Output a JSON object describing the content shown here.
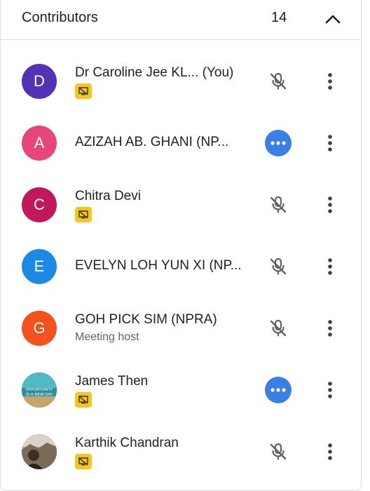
{
  "header": {
    "title": "Contributors",
    "count": "14",
    "collapse_icon": "chevron-up-icon"
  },
  "participants": [
    {
      "initial": "D",
      "name": "Dr Caroline Jee KL...",
      "tag": "(You)",
      "subtitle": "",
      "color": "#5133b8",
      "badge": true,
      "status": "mic-off"
    },
    {
      "initial": "A",
      "name": "AZIZAH AB. GHANI (NP...",
      "tag": "",
      "subtitle": "",
      "color": "#e8467a",
      "badge": false,
      "status": "more-dots"
    },
    {
      "initial": "C",
      "name": "Chitra Devi",
      "tag": "",
      "subtitle": "",
      "color": "#c2185b",
      "badge": true,
      "status": "mic-off"
    },
    {
      "initial": "E",
      "name": "EVELYN LOH YUN XI (NP...",
      "tag": "",
      "subtitle": "",
      "color": "#1e88e5",
      "badge": false,
      "status": "mic-off"
    },
    {
      "initial": "G",
      "name": "GOH PICK SIM (NPRA)",
      "tag": "",
      "subtitle": "Meeting host",
      "color": "#f4511e",
      "badge": false,
      "status": "mic-off"
    },
    {
      "initial": "",
      "name": "James Then",
      "tag": "",
      "subtitle": "",
      "color": "#2aa3a8",
      "badge": true,
      "status": "more-dots",
      "photo_text": [
        "OPPORTUNITY",
        "IS A NEW DAY"
      ]
    },
    {
      "initial": "",
      "name": "Karthik Chandran",
      "tag": "",
      "subtitle": "",
      "color": "#8a7d72",
      "badge": true,
      "status": "mic-off"
    }
  ]
}
